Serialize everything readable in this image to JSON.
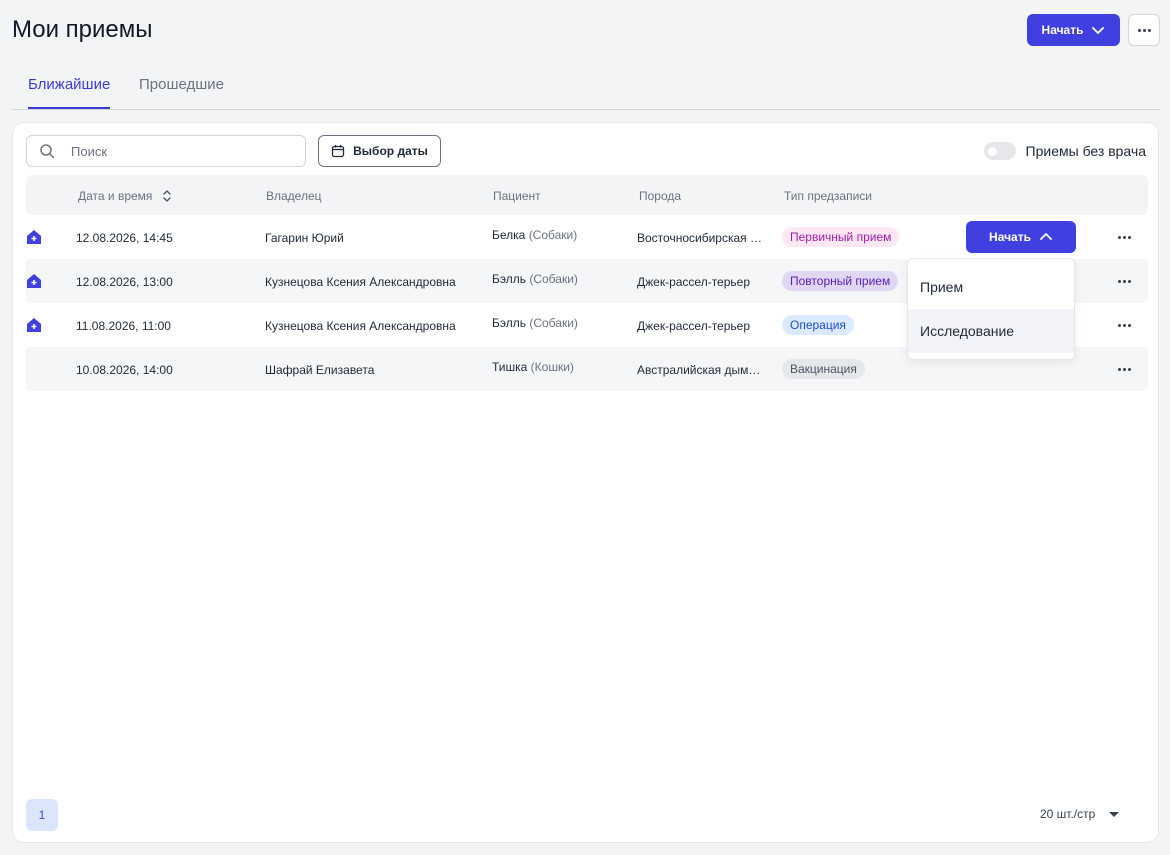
{
  "header": {
    "title": "Мои приемы",
    "start_label": "Начать"
  },
  "tabs": [
    {
      "label": "Ближайшие",
      "active": true
    },
    {
      "label": "Прошедшие",
      "active": false
    }
  ],
  "toolbar": {
    "search_placeholder": "Поиск",
    "date_button": "Выбор даты",
    "toggle_label": "Приемы без врача",
    "toggle_on": false
  },
  "table": {
    "columns": [
      "Дата и время",
      "Владелец",
      "Пациент",
      "Порода",
      "Тип предзаписи"
    ],
    "rows": [
      {
        "date": "12.08.2026, 14:45",
        "owner": "Гагарин Юрий",
        "patient": "Белка",
        "species": "(Собаки)",
        "breed": "Восточносибирская лайка",
        "type": "Первичный прием",
        "home_icon": true
      },
      {
        "date": "12.08.2026, 13:00",
        "owner": "Кузнецова Ксения Александровна",
        "patient": "Бэлль",
        "species": "(Собаки)",
        "breed": "Джек-рассел-терьер",
        "type": "Повторный прием",
        "home_icon": true
      },
      {
        "date": "11.08.2026, 11:00",
        "owner": "Кузнецова Ксения Александровна",
        "patient": "Бэлль",
        "species": "(Собаки)",
        "breed": "Джек-рассел-терьер",
        "type": "Операция",
        "home_icon": true
      },
      {
        "date": "10.08.2026, 14:00",
        "owner": "Шафрай Елизавета",
        "patient": "Тишка",
        "species": "(Кошки)",
        "breed": "Австралийская дымчатая",
        "type": "Вакцинация",
        "home_icon": false
      }
    ],
    "row_start_label": "Начать"
  },
  "dropdown": {
    "items": [
      "Прием",
      "Исследование"
    ],
    "hovered": "Исследование"
  },
  "pagination": {
    "page": "1",
    "per_page": "20 шт./стр"
  },
  "colors": {
    "accent": "#4040e0",
    "page_bg": "#f3f4f6"
  }
}
